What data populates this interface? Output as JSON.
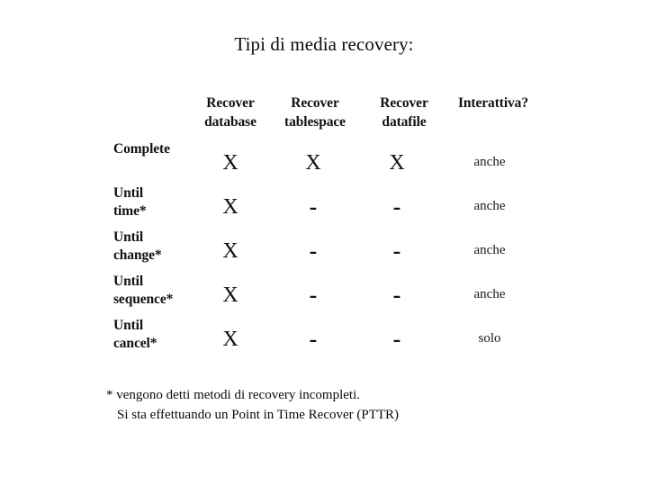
{
  "slide": {
    "title": "Tipi di media recovery:",
    "background_color": "#ffffff",
    "text_color": "#000000"
  },
  "table": {
    "columns": [
      {
        "line1": "Recover",
        "line2": "database"
      },
      {
        "line1": "Recover",
        "line2": "tablespace"
      },
      {
        "line1": "Recover",
        "line2": "datafile"
      },
      {
        "line1": "Interattiva?",
        "line2": ""
      }
    ],
    "rows": [
      {
        "label_line1": "Complete",
        "label_line2": "",
        "recover_database": "X",
        "recover_tablespace": "X",
        "recover_datafile": "X",
        "interattiva": "anche"
      },
      {
        "label_line1": "Until",
        "label_line2": "time*",
        "recover_database": "X",
        "recover_tablespace": "-",
        "recover_datafile": "-",
        "interattiva": "anche"
      },
      {
        "label_line1": "Until",
        "label_line2": "change*",
        "recover_database": "X",
        "recover_tablespace": "-",
        "recover_datafile": "-",
        "interattiva": "anche"
      },
      {
        "label_line1": "Until",
        "label_line2": "sequence*",
        "recover_database": "X",
        "recover_tablespace": "-",
        "recover_datafile": "-",
        "interattiva": "anche"
      },
      {
        "label_line1": "Until",
        "label_line2": "cancel*",
        "recover_database": "X",
        "recover_tablespace": "-",
        "recover_datafile": "-",
        "interattiva": "solo"
      }
    ]
  },
  "footnote": {
    "line1": "* vengono detti metodi di recovery incompleti.",
    "line2": "Si sta effettuando un Point in Time Recover (PTTR)"
  }
}
